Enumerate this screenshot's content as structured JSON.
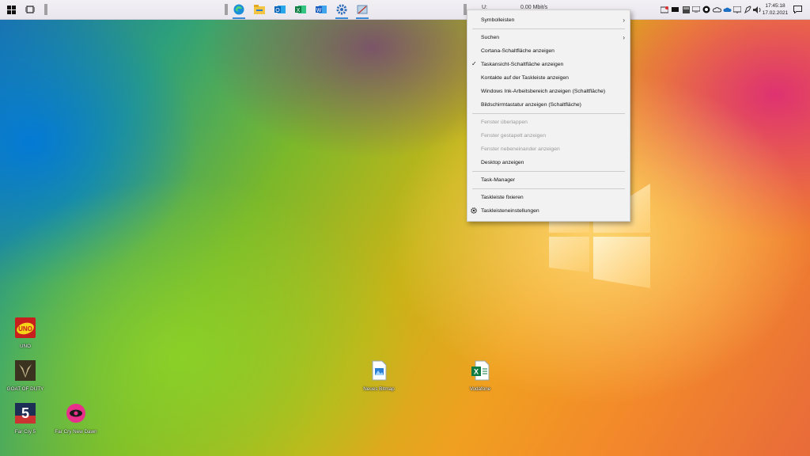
{
  "taskbar": {
    "network_speed": "0.00 Mbit/s",
    "network_label": "U:",
    "clock_time": "17:45:18",
    "clock_date": "17.02.2021"
  },
  "context_menu": {
    "items": [
      {
        "label": "Symbolleisten",
        "submenu": true
      },
      {
        "label": "Suchen",
        "submenu": true
      },
      {
        "label": "Cortana-Schaltfläche anzeigen"
      },
      {
        "label": "Taskansicht-Schaltfläche anzeigen",
        "checked": true
      },
      {
        "label": "Kontakte auf der Taskleiste anzeigen"
      },
      {
        "label": "Windows Ink-Arbeitsbereich anzeigen (Schaltfläche)"
      },
      {
        "label": "Bildschirmtastatur anzeigen (Schaltfläche)"
      },
      {
        "label": "Fenster überlappen",
        "disabled": true
      },
      {
        "label": "Fenster gestapelt anzeigen",
        "disabled": true
      },
      {
        "label": "Fenster nebeneinander anzeigen",
        "disabled": true
      },
      {
        "label": "Desktop anzeigen"
      },
      {
        "label": "Task-Manager"
      },
      {
        "label": "Taskleiste fixieren"
      },
      {
        "label": "Taskleisteneinstellungen",
        "icon": "gear-icon"
      }
    ]
  },
  "desktop": {
    "icons": [
      {
        "label": "UNO",
        "icon": "uno-game-icon"
      },
      {
        "label": "GOAT OF DUTY",
        "icon": "goat-of-duty-icon"
      },
      {
        "label": "Far Cry 5",
        "icon": "far-cry-5-icon"
      },
      {
        "label": "Far Cry New Dawn",
        "icon": "far-cry-new-dawn-icon"
      },
      {
        "label": "Neues Bitmap",
        "icon": "bitmap-file-icon"
      },
      {
        "label": "Vodafone",
        "icon": "excel-file-icon"
      }
    ]
  },
  "colors": {
    "menu_bg": "#f2f2f2",
    "taskbar_bg": "#efecf2",
    "accent": "#3a8ad8",
    "disabled_text": "#9a9a9a"
  }
}
